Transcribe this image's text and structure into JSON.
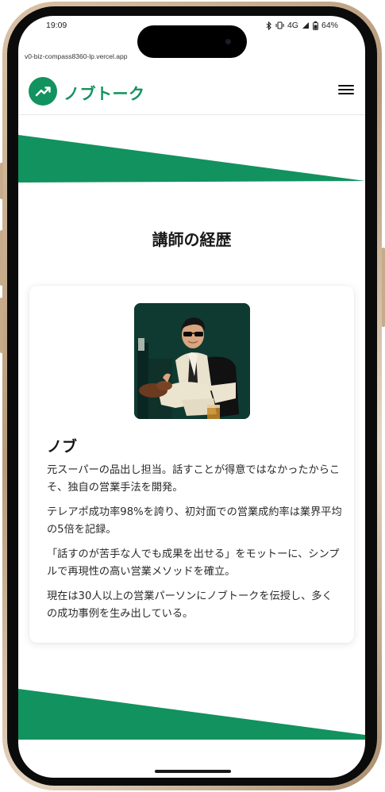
{
  "status_bar": {
    "time": "19:09",
    "network": "4G",
    "battery": "64%"
  },
  "browser": {
    "url": "v0-biz-compass8360-lp.vercel.app"
  },
  "header": {
    "brand": "ノブトーク",
    "logo_icon": "trending-up-icon",
    "menu_icon": "hamburger-icon"
  },
  "section": {
    "title": "講師の経歴"
  },
  "profile": {
    "name": "ノブ",
    "paragraphs": [
      "元スーパーの品出し担当。話すことが得意ではなかったからこそ、独自の営業手法を開発。",
      "テレアポ成功率98%を誇り、初対面での営業成約率は業界平均の5倍を記録。",
      "「話すのが苦手な人でも成果を出せる」をモットーに、シンプルで再現性の高い営業メソッドを確立。",
      "現在は30人以上の営業パーソンにノブトークを伝授し、多くの成功事例を生み出している。"
    ]
  },
  "colors": {
    "brand_green": "#12925e",
    "text_dark": "#1a1a1a"
  }
}
